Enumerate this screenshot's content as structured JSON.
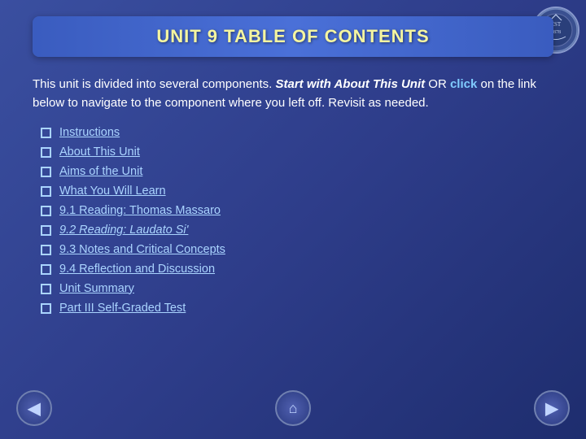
{
  "slide": {
    "title": "UNIT 9 TABLE OF CONTENTS",
    "intro": {
      "text": "This unit is divided into several components.",
      "start_label": "Start with",
      "start_italic": "About This Unit",
      "or": " OR ",
      "click_label": "click",
      "rest": " on the link below to navigate to the component where you left off. Revisit as needed."
    },
    "toc_items": [
      {
        "label": "Instructions",
        "italic": false
      },
      {
        "label": "About This Unit",
        "italic": false
      },
      {
        "label": "Aims of the Unit",
        "italic": false
      },
      {
        "label": "What You Will Learn",
        "italic": false
      },
      {
        "label": "9.1 Reading: Thomas Massaro",
        "italic": false
      },
      {
        "label": "9.2 Reading: Laudato Si'",
        "italic": true
      },
      {
        "label": "9.3 Notes and Critical Concepts",
        "italic": false
      },
      {
        "label": "9.4 Reflection and Discussion",
        "italic": false
      },
      {
        "label": "Unit Summary",
        "italic": false
      },
      {
        "label": "Part III Self-Graded Test",
        "italic": false
      }
    ],
    "nav": {
      "back_label": "◀",
      "home_label": "⌂",
      "forward_label": "▶"
    },
    "logo": {
      "line1": "EST",
      "line2": "1878"
    }
  }
}
